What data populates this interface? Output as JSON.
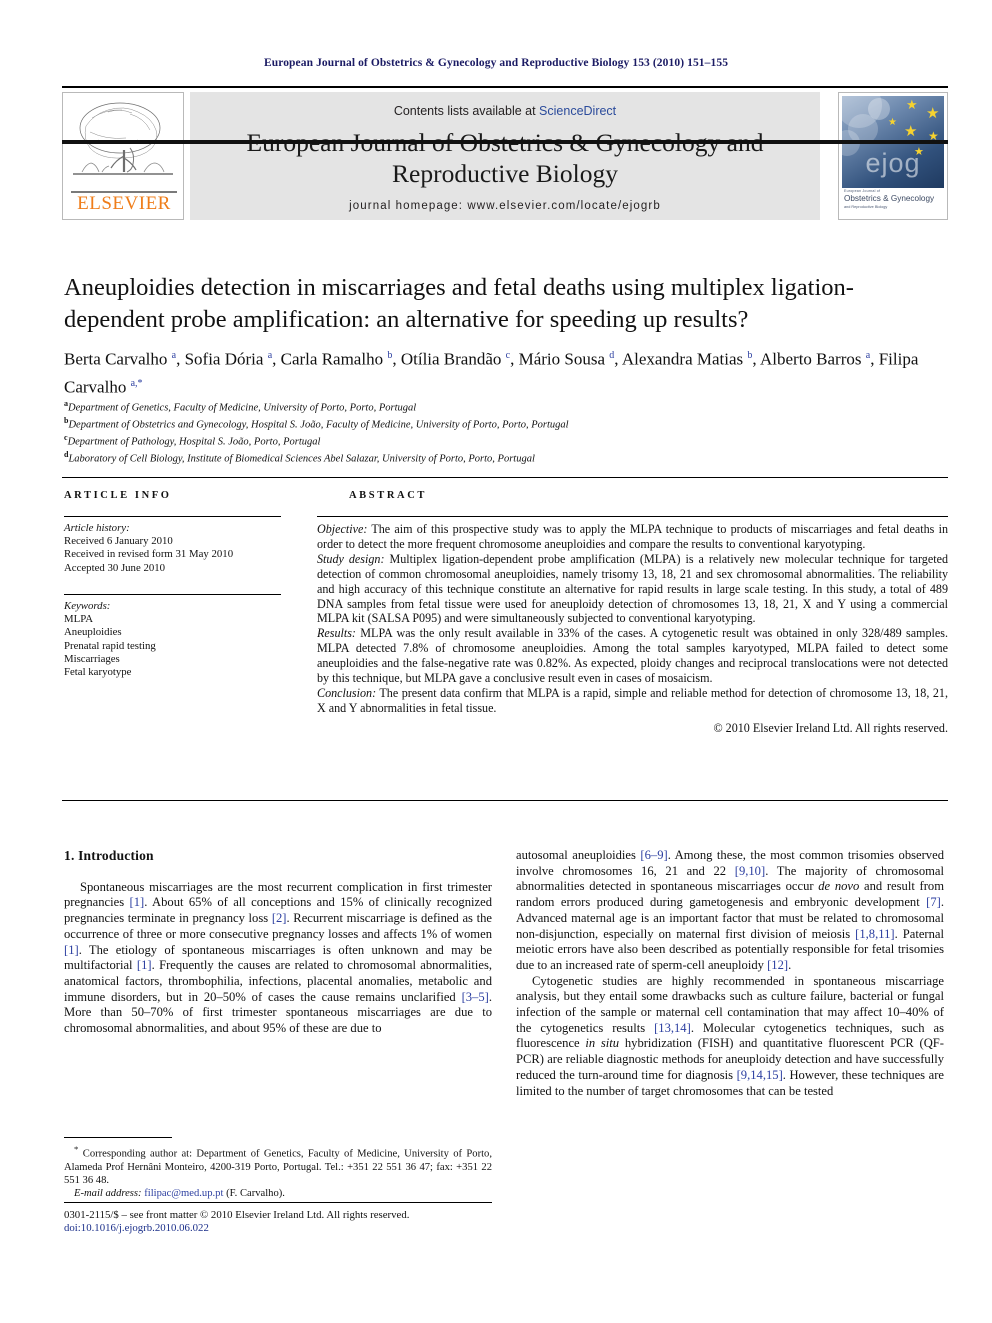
{
  "running_head": "European Journal of Obstetrics & Gynecology and Reproductive Biology 153 (2010) 151–155",
  "masthead": {
    "contents_prefix": "Contents lists available at ",
    "sciencedirect": "ScienceDirect",
    "journal_title_line1": "European Journal of Obstetrics & Gynecology and",
    "journal_title_line2": "Reproductive Biology",
    "homepage": "journal homepage: www.elsevier.com/locate/ejogrb",
    "publisher_logo_text": "ELSEVIER",
    "cover_logo_text": "ejog",
    "cover_caption_small": "European Journal of",
    "cover_caption_main": "Obstetrics & Gynecology",
    "cover_caption_sub": "and Reproductive Biology",
    "accent_orange": "#ef7d1a",
    "accent_blue": "#2b4b9b",
    "banner_bg": "#e4e4e4"
  },
  "article": {
    "title": "Aneuploidies detection in miscarriages and fetal deaths using multiplex ligation-dependent probe amplification: an alternative for speeding up results?",
    "authors_html": "Berta Carvalho <sup>a</sup>, Sofia Dória <sup>a</sup>, Carla Ramalho <sup>b</sup>, Otília Brandão <sup>c</sup>, Mário Sousa <sup>d</sup>, Alexandra Matias <sup>b</sup>, Alberto Barros <sup>a</sup>, Filipa Carvalho <sup>a,*</sup>",
    "affiliations": [
      {
        "mark": "a",
        "text": "Department of Genetics, Faculty of Medicine, University of Porto, Porto, Portugal"
      },
      {
        "mark": "b",
        "text": "Department of Obstetrics and Gynecology, Hospital S. João, Faculty of Medicine, University of Porto, Porto, Portugal"
      },
      {
        "mark": "c",
        "text": "Department of Pathology, Hospital S. João, Porto, Portugal"
      },
      {
        "mark": "d",
        "text": "Laboratory of Cell Biology, Institute of Biomedical Sciences Abel Salazar, University of Porto, Porto, Portugal"
      }
    ]
  },
  "article_info": {
    "section_label": "ARTICLE INFO",
    "history_label": "Article history:",
    "history": [
      "Received 6 January 2010",
      "Received in revised form 31 May 2010",
      "Accepted 30 June 2010"
    ],
    "keywords_label": "Keywords:",
    "keywords": [
      "MLPA",
      "Aneuploidies",
      "Prenatal rapid testing",
      "Miscarriages",
      "Fetal karyotype"
    ]
  },
  "abstract": {
    "section_label": "ABSTRACT",
    "paragraphs": [
      {
        "lead": "Objective:",
        "text": " The aim of this prospective study was to apply the MLPA technique to products of miscarriages and fetal deaths in order to detect the more frequent chromosome aneuploidies and compare the results to conventional karyotyping."
      },
      {
        "lead": "Study design:",
        "text": " Multiplex ligation-dependent probe amplification (MLPA) is a relatively new molecular technique for targeted detection of common chromosomal aneuploidies, namely trisomy 13, 18, 21 and sex chromosomal abnormalities. The reliability and high accuracy of this technique constitute an alternative for rapid results in large scale testing. In this study, a total of 489 DNA samples from fetal tissue were used for aneuploidy detection of chromosomes 13, 18, 21, X and Y using a commercial MLPA kit (SALSA P095) and were simultaneously subjected to conventional karyotyping."
      },
      {
        "lead": "Results:",
        "text": " MLPA was the only result available in 33% of the cases. A cytogenetic result was obtained in only 328/489 samples. MLPA detected 7.8% of chromosome aneuploidies. Among the total samples karyotyped, MLPA failed to detect some aneuploidies and the false-negative rate was 0.82%. As expected, ploidy changes and reciprocal translocations were not detected by this technique, but MLPA gave a conclusive result even in cases of mosaicism."
      },
      {
        "lead": "Conclusion:",
        "text": " The present data confirm that MLPA is a rapid, simple and reliable method for detection of chromosome 13, 18, 21, X and Y abnormalities in fetal tissue."
      }
    ],
    "copyright": "© 2010 Elsevier Ireland Ltd. All rights reserved."
  },
  "body": {
    "section_heading": "1. Introduction",
    "left_paragraphs_html": [
      "Spontaneous miscarriages are the most recurrent complication in first trimester pregnancies <span class=\"ref\">[1]</span>. About 65% of all conceptions and 15% of clinically recognized pregnancies terminate in pregnancy loss <span class=\"ref\">[2]</span>. Recurrent miscarriage is defined as the occurrence of three or more consecutive pregnancy losses and affects 1% of women <span class=\"ref\">[1]</span>. The etiology of spontaneous miscarriages is often unknown and may be multifactorial <span class=\"ref\">[1]</span>. Frequently the causes are related to chromosomal abnormalities, anatomical factors, thrombophilia, infections, placental anomalies, metabolic and immune disorders, but in 20–50% of cases the cause remains unclarified <span class=\"ref\">[3–5]</span>. More than 50–70% of first trimester spontaneous miscarriages are due to chromosomal abnormalities, and about 95% of these are due to"
    ],
    "right_paragraphs_html": [
      "autosomal aneuploidies <span class=\"ref\">[6–9]</span>. Among these, the most common trisomies observed involve chromosomes 16, 21 and 22 <span class=\"ref\">[9,10]</span>. The majority of chromosomal abnormalities detected in spontaneous miscarriages occur <span class=\"it\">de novo</span> and result from random errors produced during gametogenesis and embryonic development <span class=\"ref\">[7]</span>. Advanced maternal age is an important factor that must be related to chromosomal non-disjunction, especially on maternal first division of meiosis <span class=\"ref\">[1,8,11]</span>. Paternal meiotic errors have also been described as potentially responsible for fetal trisomies due to an increased rate of sperm-cell aneuploidy <span class=\"ref\">[12]</span>.",
      "Cytogenetic studies are highly recommended in spontaneous miscarriage analysis, but they entail some drawbacks such as culture failure, bacterial or fungal infection of the sample or maternal cell contamination that may affect 10–40% of the cytogenetics results <span class=\"ref\">[13,14]</span>. Molecular cytogenetics techniques, such as fluorescence <span class=\"it\">in situ</span> hybridization (FISH) and quantitative fluorescent PCR (QF-PCR) are reliable diagnostic methods for aneuploidy detection and have successfully reduced the turn-around time for diagnosis <span class=\"ref\">[9,14,15]</span>. However, these techniques are limited to the number of target chromosomes that can be tested"
    ]
  },
  "footnote": {
    "corresponding_html": "<sup>*</sup> Corresponding author at: Department of Genetics, Faculty of Medicine, University of Porto, Alameda Prof Hernâni Monteiro, 4200-319 Porto, Portugal. Tel.: +351 22 551 36 47; fax: +351 22 551 36 48.",
    "email_label": "E-mail address:",
    "email": "filipac@med.up.pt",
    "email_suffix": " (F. Carvalho)."
  },
  "footer": {
    "issn_line": "0301-2115/$ – see front matter © 2010 Elsevier Ireland Ltd. All rights reserved.",
    "doi": "doi:10.1016/j.ejogrb.2010.06.022"
  }
}
